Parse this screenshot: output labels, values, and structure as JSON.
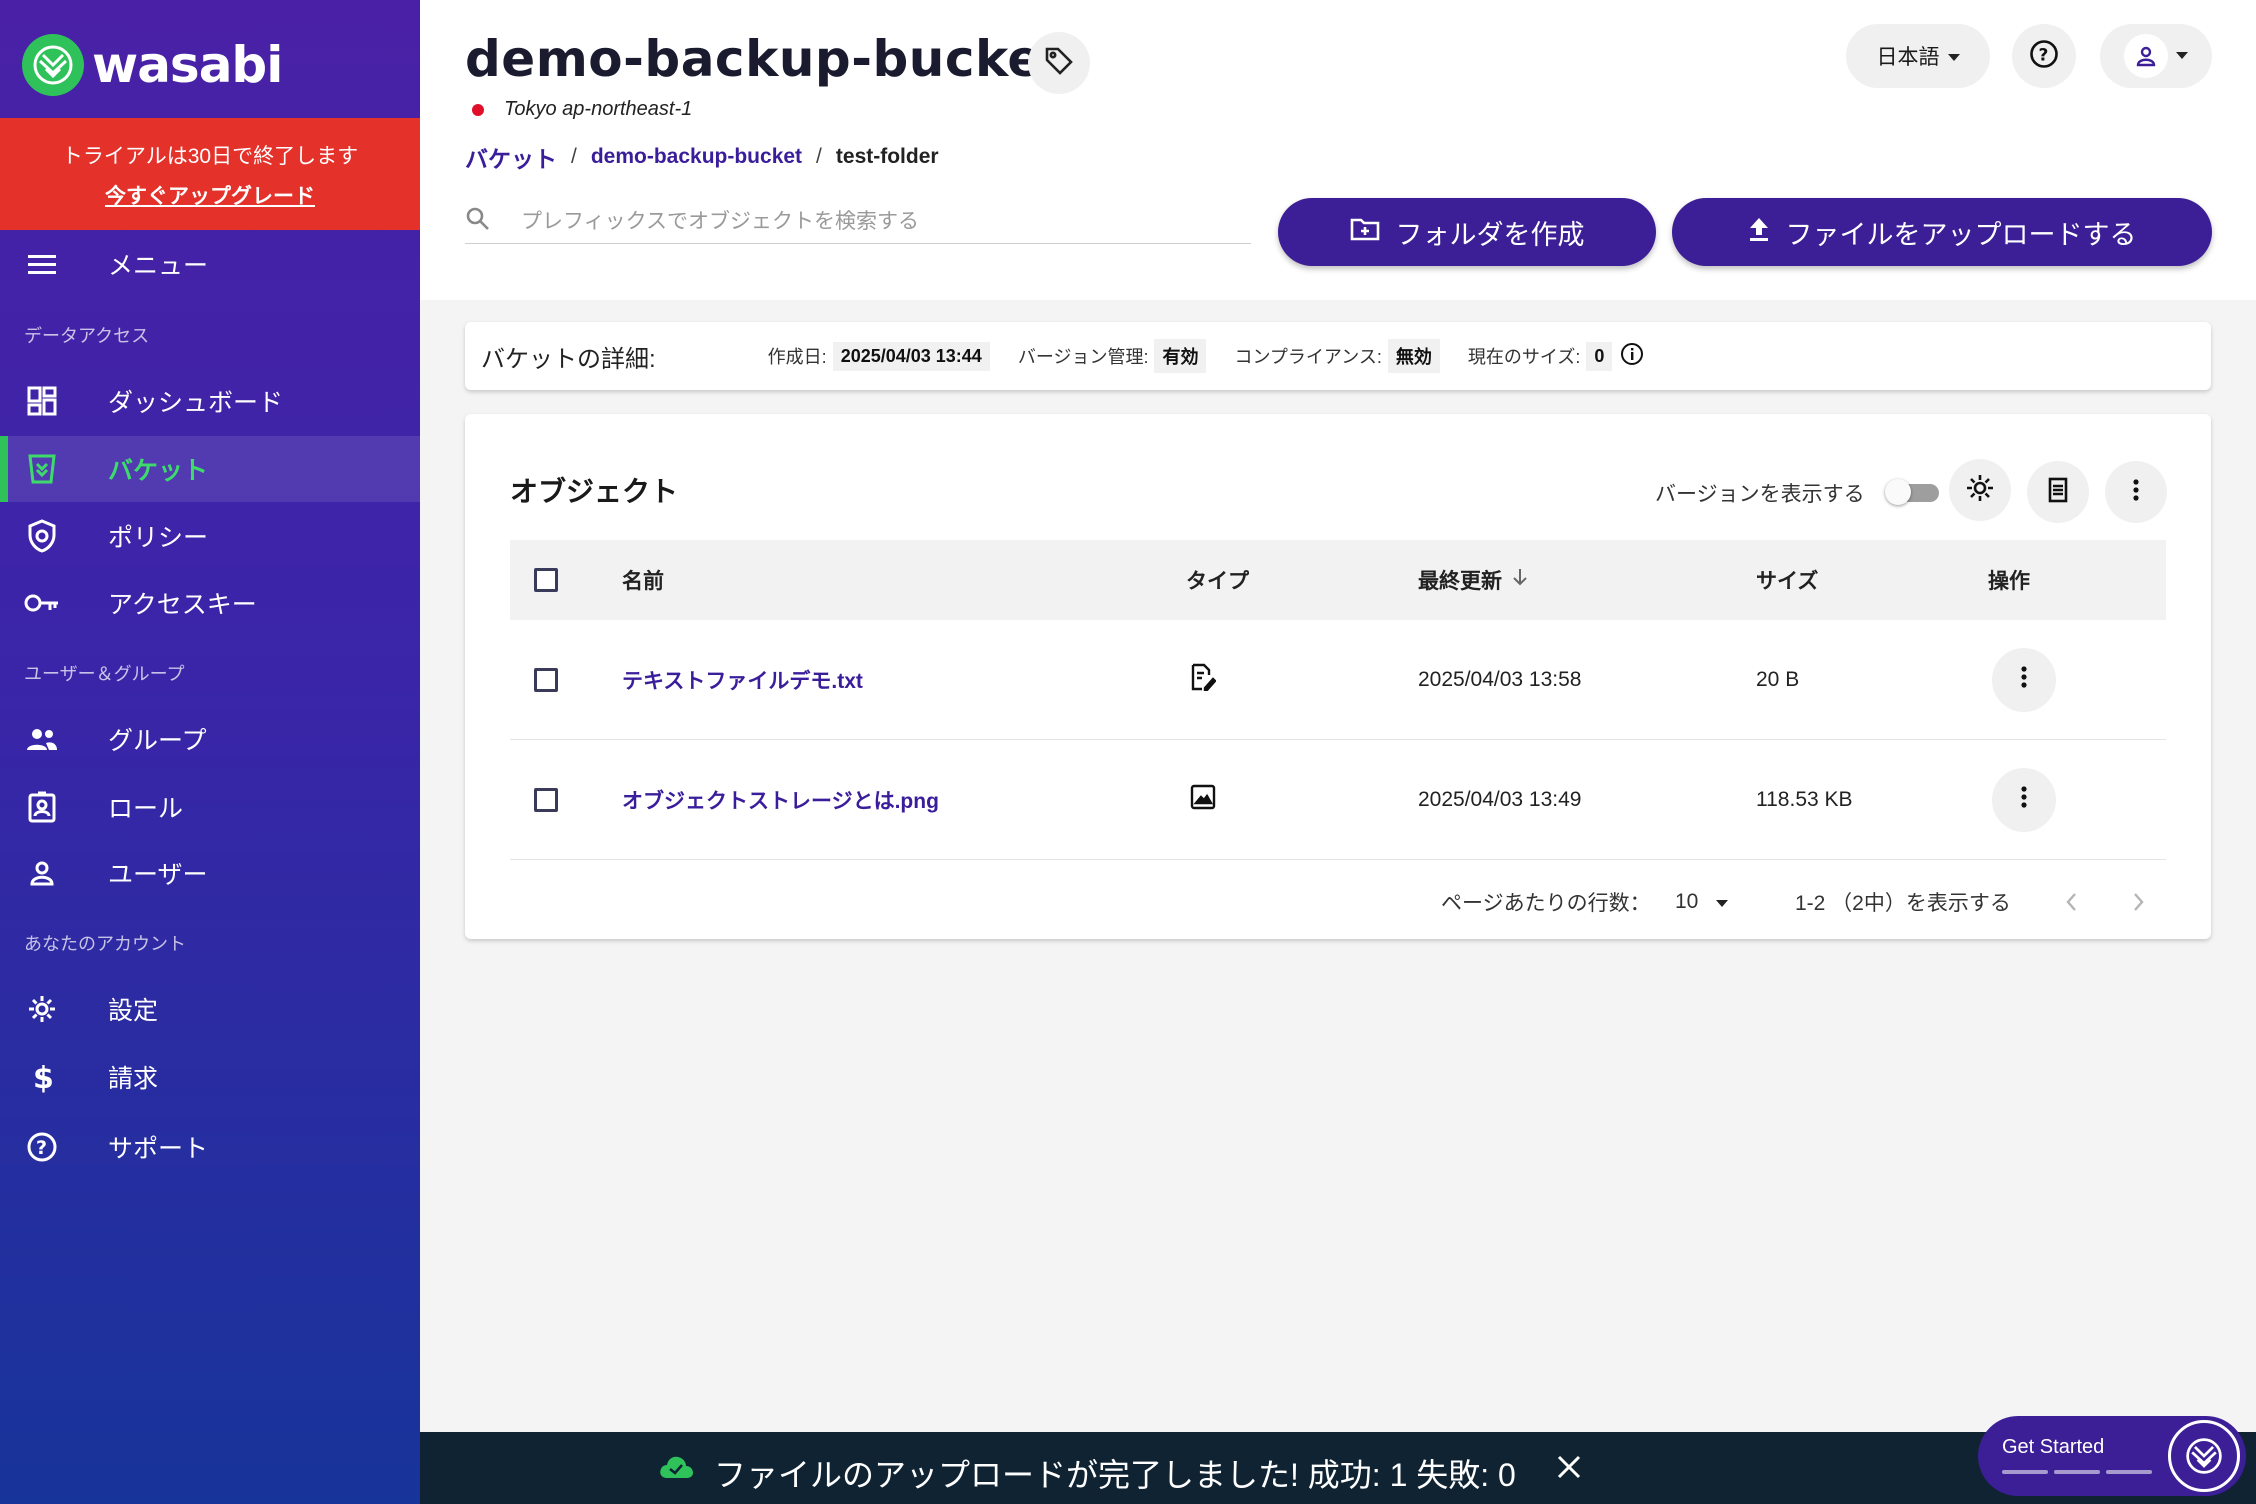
{
  "brand": {
    "name": "wasabi",
    "accent": "#3c1f96",
    "green": "#2fc25b",
    "alert_red": "#e4312a"
  },
  "trial": {
    "message": "トライアルは30日で終了します",
    "upgrade_link": "今すぐアップグレード"
  },
  "sidebar": {
    "menu_label": "メニュー",
    "sections": {
      "data_access": "データアクセス",
      "users_groups": "ユーザー＆グループ",
      "account": "あなたのアカウント"
    },
    "items": [
      {
        "label": "ダッシュボード",
        "icon": "dashboard-icon"
      },
      {
        "label": "バケット",
        "icon": "bucket-icon",
        "active": true
      },
      {
        "label": "ポリシー",
        "icon": "shield-icon"
      },
      {
        "label": "アクセスキー",
        "icon": "key-icon"
      },
      {
        "label": "グループ",
        "icon": "group-icon"
      },
      {
        "label": "ロール",
        "icon": "badge-icon"
      },
      {
        "label": "ユーザー",
        "icon": "user-icon"
      },
      {
        "label": "設定",
        "icon": "gear-icon"
      },
      {
        "label": "請求",
        "icon": "dollar-icon"
      },
      {
        "label": "サポート",
        "icon": "help-icon"
      }
    ]
  },
  "header": {
    "bucket_name": "demo-backup-bucket",
    "region": "Tokyo ap-northeast-1",
    "breadcrumb": {
      "root": "バケット",
      "bucket": "demo-backup-bucket",
      "current": "test-folder"
    },
    "search_placeholder": "プレフィックスでオブジェクトを検索する",
    "create_folder": "フォルダを作成",
    "upload_file": "ファイルをアップロードする",
    "language": "日本語"
  },
  "details": {
    "title": "バケットの詳細:",
    "created_label": "作成日:",
    "created_value": "2025/04/03 13:44",
    "versioning_label": "バージョン管理:",
    "versioning_value": "有効",
    "compliance_label": "コンプライアンス:",
    "compliance_value": "無効",
    "size_label": "現在のサイズ:",
    "size_value": "0"
  },
  "objects": {
    "title": "オブジェクト",
    "show_versions": "バージョンを表示する",
    "show_versions_enabled": false,
    "columns": {
      "name": "名前",
      "type": "タイプ",
      "modified": "最終更新",
      "size": "サイズ",
      "actions": "操作"
    },
    "rows": [
      {
        "name": "テキストファイルデモ.txt",
        "type_icon": "text-file-icon",
        "modified": "2025/04/03 13:58",
        "size": "20 B"
      },
      {
        "name": "オブジェクトストレージとは.png",
        "type_icon": "image-file-icon",
        "modified": "2025/04/03 13:49",
        "size": "118.53 KB"
      }
    ],
    "pagination": {
      "rows_per_page_label": "ページあたりの行数：",
      "rows_per_page": "10",
      "range": "1-2 （2中）を表示する"
    }
  },
  "toast": {
    "message": "ファイルのアップロードが完了しました! 成功: 1 失敗: 0"
  },
  "get_started": {
    "label": "Get Started"
  }
}
